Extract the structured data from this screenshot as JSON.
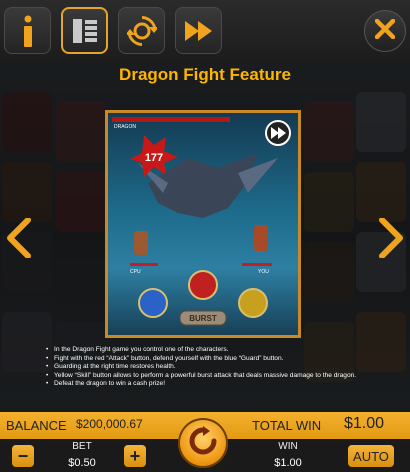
{
  "toolbar": {
    "buttons": [
      {
        "name": "info",
        "icon": "info-icon"
      },
      {
        "name": "paytable",
        "icon": "paytable-icon",
        "active": true
      },
      {
        "name": "autoplay",
        "icon": "cycle-icon"
      },
      {
        "name": "fast",
        "icon": "fast-forward-icon"
      }
    ],
    "close_icon": "close-icon",
    "accent": "#f0a41e"
  },
  "help": {
    "title": "Dragon Fight Feature",
    "scene": {
      "boss_label": "DRAGON",
      "damage": "177",
      "cpu_label": "CPU",
      "you_label": "YOU",
      "burst_label": "BURST",
      "skip_icon": "skip-icon"
    },
    "bullets": [
      "In the Dragon Fight game you control one of the characters.",
      "Fight with the red “Attack” button, defend yourself with the blue “Guard” button.",
      "Guarding at the right time restores health.",
      "Yellow “Skill” button allows to perform a powerful burst attack that deals massive damage to the dragon.",
      "Defeat the dragon to win a cash prize!"
    ],
    "prev_icon": "chevron-left-icon",
    "next_icon": "chevron-right-icon"
  },
  "footer": {
    "balance_label": "BALANCE",
    "balance_value": "$200,000.67",
    "total_win_label": "TOTAL WIN",
    "total_win_value": "$1.00",
    "bet_label": "BET",
    "bet_value": "$0.50",
    "win_label": "WIN",
    "win_value": "$1.00",
    "auto_label": "AUTO",
    "minus_label": "−",
    "plus_label": "+",
    "spin_icon": "spin-icon"
  }
}
